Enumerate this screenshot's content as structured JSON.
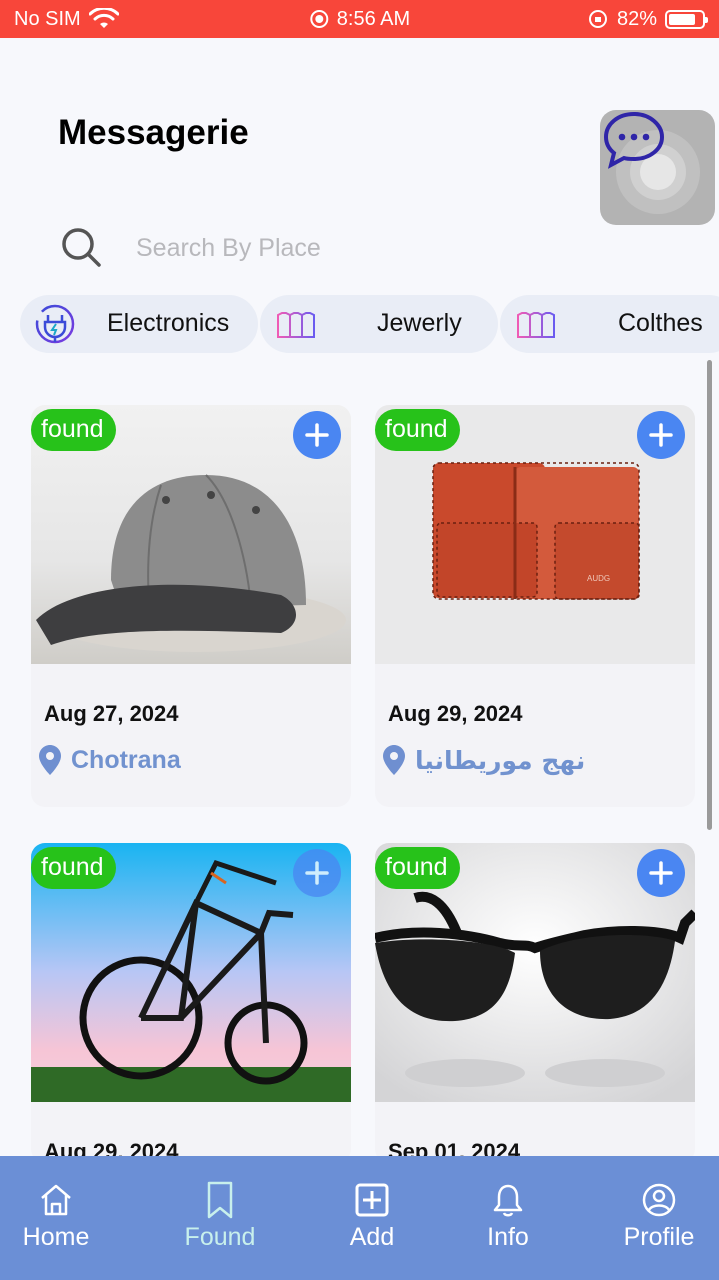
{
  "status_bar": {
    "carrier": "No SIM",
    "time": "8:56 AM",
    "battery": "82%",
    "battery_level": 0.82,
    "color": "#f8463a"
  },
  "header": {
    "title": "Messagerie"
  },
  "search": {
    "placeholder": "Search By Place"
  },
  "categories": [
    {
      "label": "Electronics",
      "icon": "plug-icon"
    },
    {
      "label": "Jewerly",
      "icon": "clothes-rack-icon"
    },
    {
      "label": "Colthes",
      "icon": "clothes-rack-icon"
    }
  ],
  "cards": [
    {
      "badge": "found",
      "date": "Aug 27, 2024",
      "location": "Chotrana",
      "image": "cap-image"
    },
    {
      "badge": "found",
      "date": "Aug 29, 2024",
      "location": "نهج موريطانيا",
      "image": "wallet-image"
    },
    {
      "badge": "found",
      "date": "Aug 29, 2024",
      "location": "",
      "image": "bicycle-image"
    },
    {
      "badge": "found",
      "date": "Sep 01, 2024",
      "location": "",
      "image": "sunglasses-image"
    }
  ],
  "nav": [
    {
      "label": "Home",
      "icon": "home-icon"
    },
    {
      "label": "Found",
      "icon": "bookmark-icon",
      "active": true
    },
    {
      "label": "Add",
      "icon": "add-square-icon"
    },
    {
      "label": "Info",
      "icon": "bell-icon"
    },
    {
      "label": "Profile",
      "icon": "profile-icon"
    }
  ],
  "colors": {
    "accent": "#4a86f2",
    "found": "#27c21a",
    "nav_bg": "#6b8fd6",
    "location": "#7192cf"
  }
}
